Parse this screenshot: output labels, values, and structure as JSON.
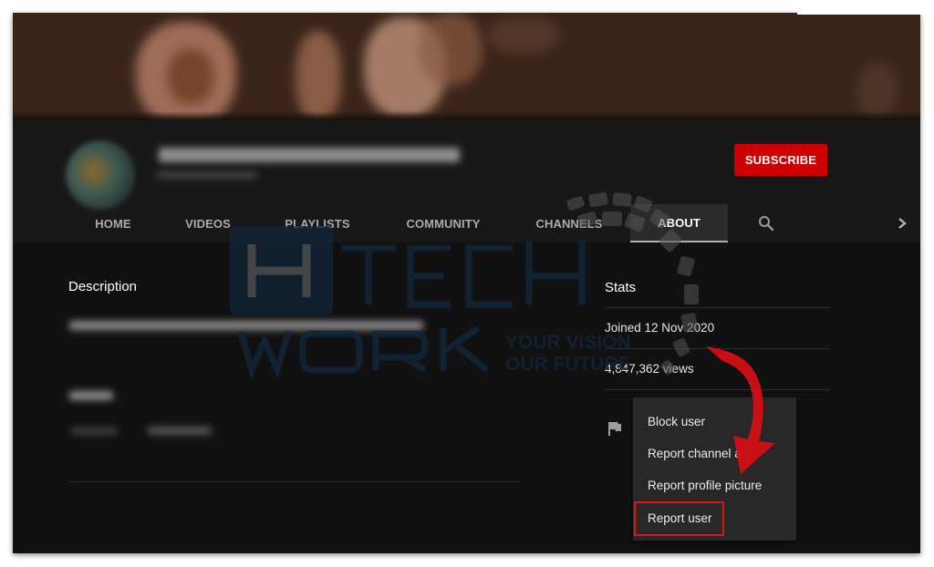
{
  "channel": {
    "subscribe_label": "SUBSCRIBE",
    "accent_color": "#cc0000"
  },
  "tabs": [
    {
      "label": "HOME",
      "active": false
    },
    {
      "label": "VIDEOS",
      "active": false
    },
    {
      "label": "PLAYLISTS",
      "active": false
    },
    {
      "label": "COMMUNITY",
      "active": false
    },
    {
      "label": "CHANNELS",
      "active": false
    },
    {
      "label": "ABOUT",
      "active": true
    }
  ],
  "tab_icons": {
    "search": "search-icon",
    "next": "chevron-right-icon"
  },
  "about": {
    "description_title": "Description",
    "stats_title": "Stats",
    "joined": "Joined 12 Nov 2020",
    "views": "4,847,362 views"
  },
  "report_menu": {
    "icon": "flag-icon",
    "items": [
      {
        "label": "Block user"
      },
      {
        "label": "Report channel a"
      },
      {
        "label": "Report profile picture"
      },
      {
        "label": "Report user",
        "highlighted": true
      }
    ],
    "highlight_color": "#d9141b"
  },
  "watermark": {
    "line1": "HI TECH",
    "line2": "WORK",
    "tagline1": "YOUR VISION",
    "tagline2": "OUR FUTURE"
  }
}
